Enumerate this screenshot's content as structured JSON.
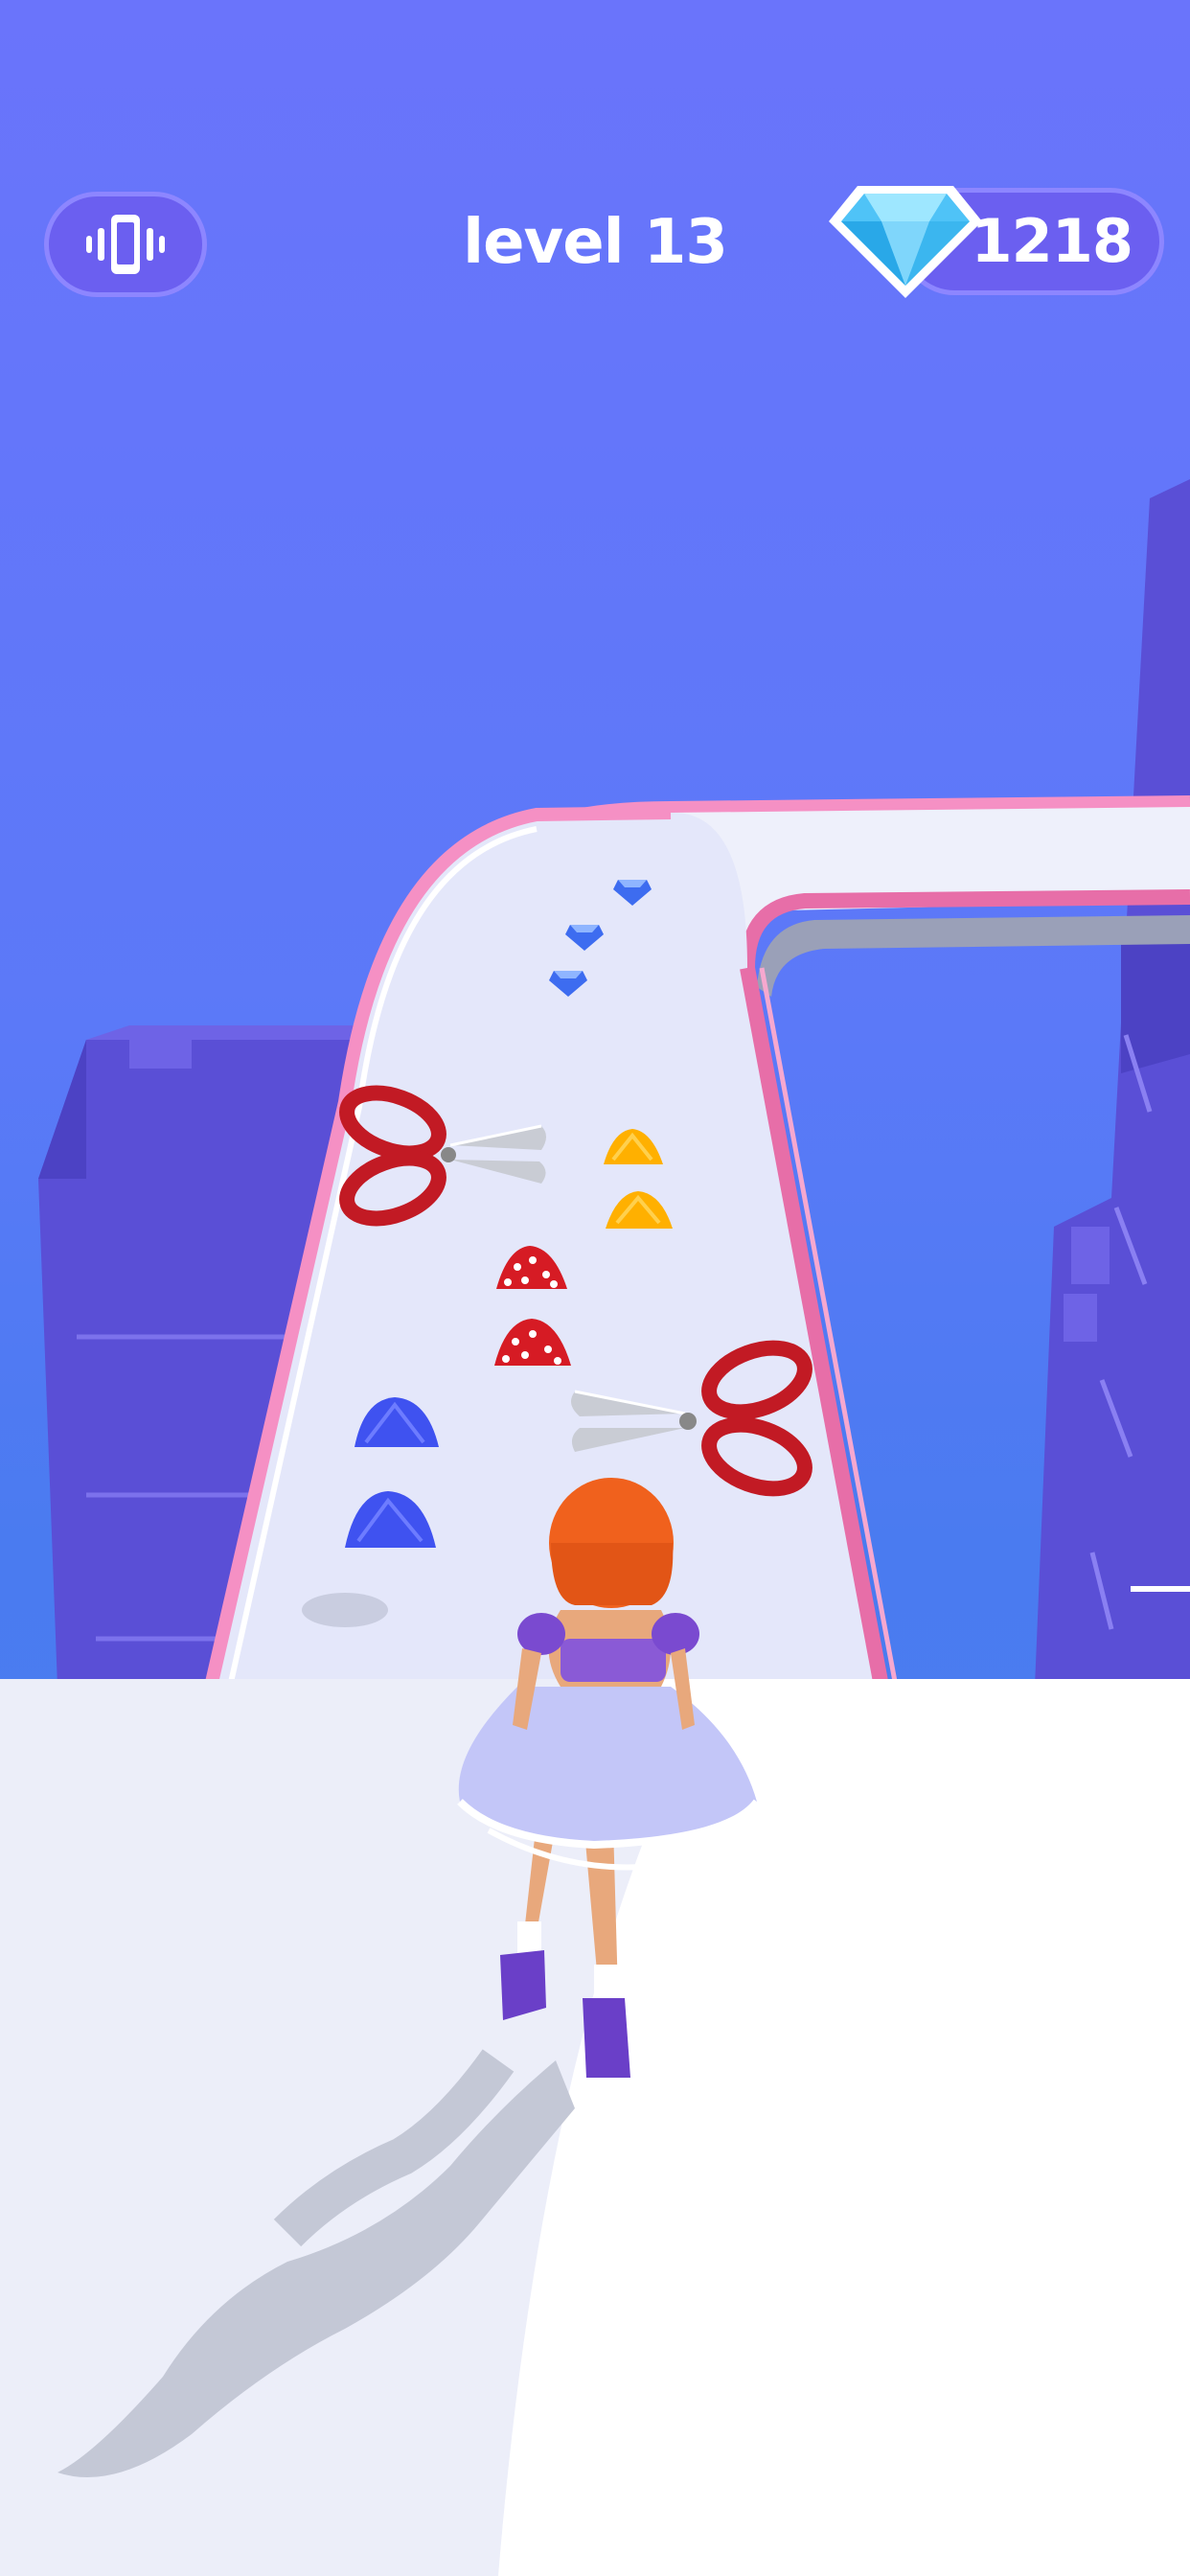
{
  "hud": {
    "level_label": "level 13",
    "gem_count": "1218",
    "vibration_icon": "phone-vibrate-icon",
    "gem_icon": "diamond-icon"
  },
  "scene": {
    "obstacles": [
      "scissors",
      "scissors"
    ],
    "pickups": [
      "blue-gem",
      "blue-gem",
      "blue-gem",
      "yellow-skirt",
      "yellow-skirt",
      "red-polka-dot-skirt",
      "red-polka-dot-skirt",
      "blue-skirt",
      "blue-skirt"
    ],
    "player": "runner-girl"
  },
  "colors": {
    "sky": "#6a74fb",
    "track": "#e6e9fb",
    "rail": "#f08cc0",
    "building": "#5a4fd6",
    "hud_pill": "#6b5ff0",
    "hud_border": "#8d86ff"
  }
}
